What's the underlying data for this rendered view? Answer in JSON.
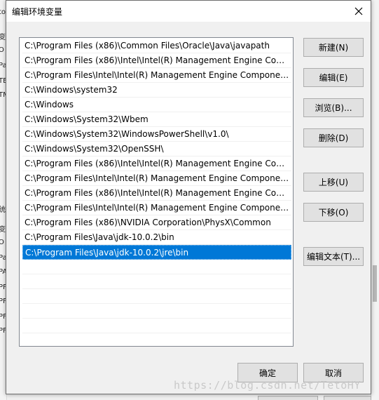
{
  "dialog": {
    "title": "编辑环境变量",
    "close_icon": "close-icon"
  },
  "paths": [
    "C:\\Program Files (x86)\\Common Files\\Oracle\\Java\\javapath",
    "C:\\Program Files (x86)\\Intel\\Intel(R) Management Engine Comp...",
    "C:\\Program Files\\Intel\\Intel(R) Management Engine Component...",
    "C:\\Windows\\system32",
    "C:\\Windows",
    "C:\\Windows\\System32\\Wbem",
    "C:\\Windows\\System32\\WindowsPowerShell\\v1.0\\",
    "C:\\Windows\\System32\\OpenSSH\\",
    "C:\\Program Files (x86)\\Intel\\Intel(R) Management Engine Comp...",
    "C:\\Program Files\\Intel\\Intel(R) Management Engine Component...",
    "C:\\Program Files (x86)\\Intel\\Intel(R) Management Engine Comp...",
    "C:\\Program Files\\Intel\\Intel(R) Management Engine Component...",
    "C:\\Program Files (x86)\\NVIDIA Corporation\\PhysX\\Common",
    "C:\\Program Files\\Java\\jdk-10.0.2\\bin",
    "C:\\Program Files\\Java\\jdk-10.0.2\\jre\\bin"
  ],
  "selected_index": 14,
  "empty_rows": 5,
  "buttons": {
    "new": "新建(N)",
    "edit": "编辑(E)",
    "browse": "浏览(B)...",
    "delete": "删除(D)",
    "move_up": "上移(U)",
    "move_down": "下移(O)",
    "edit_text": "编辑文本(T)...",
    "ok": "确定",
    "cancel": "取消"
  },
  "watermark": "https://blog.csdn.net/TetoHY",
  "background": {
    "left_fragments": [
      "to",
      "变",
      "O",
      "Pa",
      "TE",
      "TM",
      "统",
      "变",
      "O",
      "Pa",
      "PA",
      "PF",
      "PF",
      "PF",
      "PF"
    ]
  },
  "colors": {
    "selection": "#0078d7",
    "button_face": "#e1e1e1",
    "button_border": "#adadad",
    "dialog_bg": "#f0f0f0"
  }
}
